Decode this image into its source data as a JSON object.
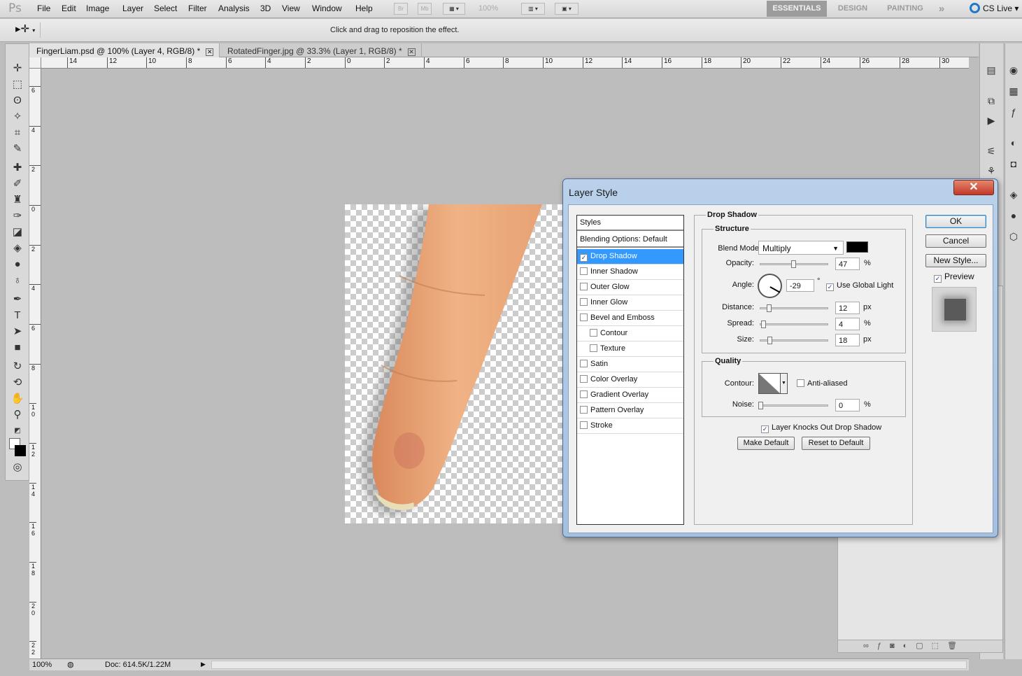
{
  "menubar": {
    "app_logo": "Ps",
    "items": [
      "File",
      "Edit",
      "Image",
      "Layer",
      "Select",
      "Filter",
      "Analysis",
      "3D",
      "View",
      "Window",
      "Help"
    ],
    "bridge": "Br",
    "minibridge": "Mb",
    "zoom": "100%",
    "workspaces": [
      "ESSENTIALS",
      "DESIGN",
      "PAINTING"
    ],
    "more": "»",
    "cs_live": "CS Live"
  },
  "options": {
    "hint": "Click and drag to reposition the effect."
  },
  "tabs": [
    {
      "label": "FingerLiam.psd @ 100% (Layer 4, RGB/8) *"
    },
    {
      "label": "RotatedFinger.jpg @ 33.3% (Layer 1, RGB/8) *"
    }
  ],
  "rulers": {
    "horizontal": [
      "14",
      "12",
      "10",
      "8",
      "6",
      "4",
      "2",
      "0",
      "2",
      "4",
      "6",
      "8",
      "10",
      "12",
      "14",
      "16",
      "18",
      "20",
      "22",
      "24",
      "26",
      "28",
      "30"
    ],
    "vertical": [
      "6",
      "4",
      "2",
      "0",
      "2",
      "4",
      "6",
      "8",
      "10",
      "12",
      "14",
      "16",
      "18",
      "20",
      "22"
    ]
  },
  "status": {
    "zoom": "100%",
    "doc": "Doc: 614.5K/1.22M"
  },
  "dialog": {
    "title": "Layer Style",
    "close": "✕",
    "styles_header": "Styles",
    "blending_options": "Blending Options: Default",
    "effects": [
      {
        "label": "Drop Shadow",
        "checked": true,
        "selected": true,
        "indent": false
      },
      {
        "label": "Inner Shadow",
        "checked": false,
        "indent": false
      },
      {
        "label": "Outer Glow",
        "checked": false,
        "indent": false
      },
      {
        "label": "Inner Glow",
        "checked": false,
        "indent": false
      },
      {
        "label": "Bevel and Emboss",
        "checked": false,
        "indent": false
      },
      {
        "label": "Contour",
        "checked": false,
        "indent": true
      },
      {
        "label": "Texture",
        "checked": false,
        "indent": true
      },
      {
        "label": "Satin",
        "checked": false,
        "indent": false
      },
      {
        "label": "Color Overlay",
        "checked": false,
        "indent": false
      },
      {
        "label": "Gradient Overlay",
        "checked": false,
        "indent": false
      },
      {
        "label": "Pattern Overlay",
        "checked": false,
        "indent": false
      },
      {
        "label": "Stroke",
        "checked": false,
        "indent": false
      }
    ],
    "drop_shadow": {
      "title": "Drop Shadow",
      "structure": "Structure",
      "blend_mode_label": "Blend Mode:",
      "blend_mode": "Multiply",
      "color": "#000000",
      "opacity_label": "Opacity:",
      "opacity": "47",
      "angle_label": "Angle:",
      "angle": "-29",
      "degree": "°",
      "use_global_light": "Use Global Light",
      "distance_label": "Distance:",
      "distance": "12",
      "spread_label": "Spread:",
      "spread": "4",
      "size_label": "Size:",
      "size": "18",
      "px": "px",
      "percent": "%",
      "quality": "Quality",
      "contour_label": "Contour:",
      "anti_aliased": "Anti-aliased",
      "noise_label": "Noise:",
      "noise": "0",
      "knocks_out": "Layer Knocks Out Drop Shadow",
      "make_default": "Make Default",
      "reset_default": "Reset to Default"
    },
    "buttons": {
      "ok": "OK",
      "cancel": "Cancel",
      "new_style": "New Style...",
      "preview": "Preview"
    }
  }
}
